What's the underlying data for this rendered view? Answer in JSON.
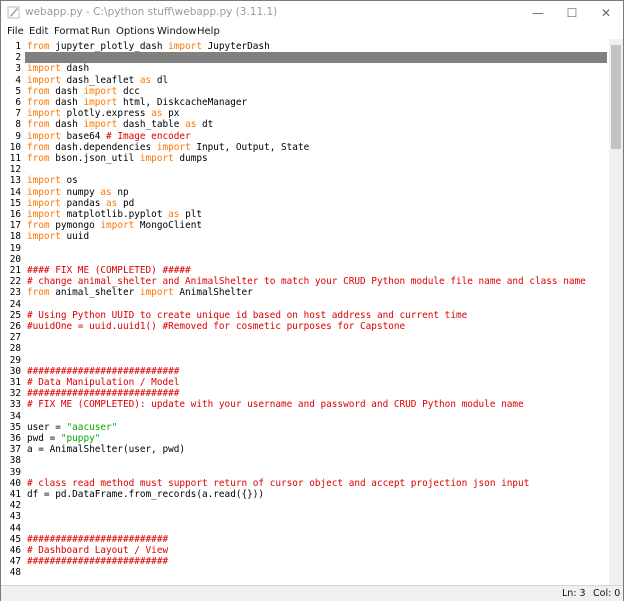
{
  "window": {
    "title": "webapp.py - C:\\python stuff\\webapp.py (3.11.1)",
    "controls": {
      "minimize": "—",
      "maximize": "☐",
      "close": "✕"
    },
    "icons": {
      "app": "python-feather-icon"
    }
  },
  "menu": {
    "items": [
      "File",
      "Edit",
      "Format",
      "Run",
      "Options",
      "Window",
      "Help"
    ]
  },
  "editor": {
    "current_line": 2,
    "colors": {
      "keyword": "#ff7700",
      "comment": "#dd0000",
      "string": "#00aa00",
      "current_line_bg": "#808080"
    },
    "lines": [
      {
        "n": "1",
        "t": "from jupyter_plotly_dash import JupyterDash"
      },
      {
        "n": "2",
        "t": ""
      },
      {
        "n": "3",
        "t": "import dash"
      },
      {
        "n": "4",
        "t": "import dash_leaflet as dl"
      },
      {
        "n": "5",
        "t": "from dash import dcc"
      },
      {
        "n": "6",
        "t": "from dash import html, DiskcacheManager"
      },
      {
        "n": "7",
        "t": "import plotly.express as px"
      },
      {
        "n": "8",
        "t": "from dash import dash_table as dt"
      },
      {
        "n": "9",
        "t": "import base64 # Image encoder"
      },
      {
        "n": "10",
        "t": "from dash.dependencies import Input, Output, State"
      },
      {
        "n": "11",
        "t": "from bson.json_util import dumps"
      },
      {
        "n": "12",
        "t": ""
      },
      {
        "n": "13",
        "t": "import os"
      },
      {
        "n": "14",
        "t": "import numpy as np"
      },
      {
        "n": "15",
        "t": "import pandas as pd"
      },
      {
        "n": "16",
        "t": "import matplotlib.pyplot as plt"
      },
      {
        "n": "17",
        "t": "from pymongo import MongoClient"
      },
      {
        "n": "18",
        "t": "import uuid"
      },
      {
        "n": "19",
        "t": ""
      },
      {
        "n": "20",
        "t": ""
      },
      {
        "n": "21",
        "t": "#### FIX ME (COMPLETED) #####"
      },
      {
        "n": "22",
        "t": "# change animal_shelter and AnimalShelter to match your CRUD Python module file name and class name"
      },
      {
        "n": "23",
        "t": "from animal_shelter import AnimalShelter"
      },
      {
        "n": "24",
        "t": ""
      },
      {
        "n": "25",
        "t": "# Using Python UUID to create unique id based on host address and current time"
      },
      {
        "n": "26",
        "t": "#uuidOne = uuid.uuid1() #Removed for cosmetic purposes for Capstone"
      },
      {
        "n": "27",
        "t": ""
      },
      {
        "n": "28",
        "t": ""
      },
      {
        "n": "29",
        "t": ""
      },
      {
        "n": "30",
        "t": "###########################"
      },
      {
        "n": "31",
        "t": "# Data Manipulation / Model"
      },
      {
        "n": "32",
        "t": "###########################"
      },
      {
        "n": "33",
        "t": "# FIX ME (COMPLETED): update with your username and password and CRUD Python module name"
      },
      {
        "n": "34",
        "t": ""
      },
      {
        "n": "35",
        "t": "user = \"aacuser\""
      },
      {
        "n": "36",
        "t": "pwd = \"puppy\""
      },
      {
        "n": "37",
        "t": "a = AnimalShelter(user, pwd)"
      },
      {
        "n": "38",
        "t": ""
      },
      {
        "n": "39",
        "t": ""
      },
      {
        "n": "40",
        "t": "# class read method must support return of cursor object and accept projection json input"
      },
      {
        "n": "41",
        "t": "df = pd.DataFrame.from_records(a.read({}))"
      },
      {
        "n": "42",
        "t": ""
      },
      {
        "n": "43",
        "t": ""
      },
      {
        "n": "44",
        "t": ""
      },
      {
        "n": "45",
        "t": "#########################"
      },
      {
        "n": "46",
        "t": "# Dashboard Layout / View"
      },
      {
        "n": "47",
        "t": "#########################"
      },
      {
        "n": "48",
        "t": ""
      }
    ]
  },
  "status": {
    "line": "Ln: 3",
    "col": "Col: 0"
  }
}
